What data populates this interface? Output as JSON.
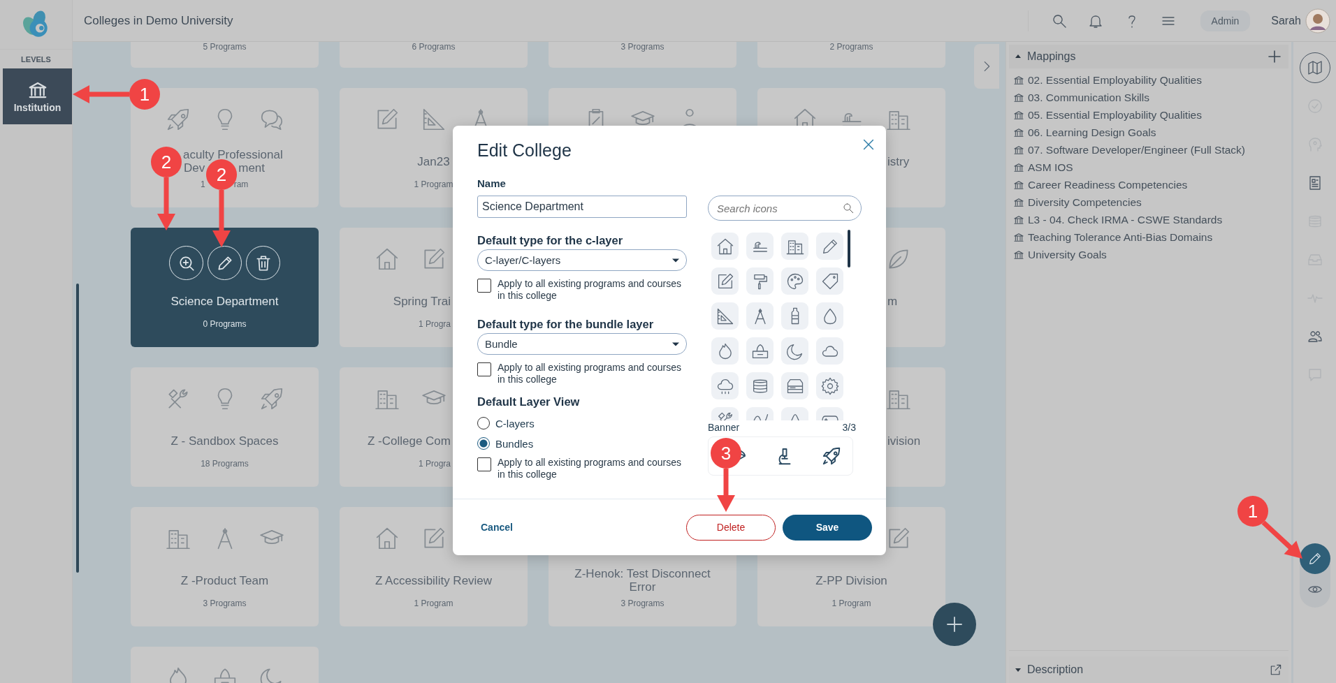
{
  "top_bar": {
    "title": "Colleges in Demo University",
    "role": "Admin",
    "user": "Sarah"
  },
  "sidebar": {
    "heading": "LEVELS",
    "items": [
      {
        "label": "Institution",
        "selected": true
      }
    ]
  },
  "cards": [
    {
      "count": "5 Programs",
      "selected": false
    },
    {
      "count": "6 Programs",
      "selected": false
    },
    {
      "count": "3 Programs",
      "selected": false
    },
    {
      "count": "2 Programs",
      "selected": false
    },
    {
      "title_parts": [
        "aculty Professional",
        "Dev",
        "ment"
      ],
      "count_parts": [
        "1",
        "ram"
      ],
      "selected": false
    },
    {
      "title": "Jan23",
      "count": "1 Program",
      "selected": false
    },
    {
      "selected": false
    },
    {
      "title": "istry",
      "selected": false
    },
    {
      "title": "Science Department",
      "count": "0 Programs",
      "selected": true
    },
    {
      "title": "Spring Trai",
      "count": "1 Progra",
      "selected": false
    },
    {
      "title": "m",
      "selected": false
    },
    {
      "title": "Z - Sandbox Spaces",
      "count": "18 Programs",
      "selected": false
    },
    {
      "title": "Z -College Com",
      "count": "1 Progra",
      "selected": false
    },
    {
      "title": "ivision",
      "selected": false
    },
    {
      "title": "Z -Product Team",
      "count": "3 Programs",
      "selected": false
    },
    {
      "title": "Z Accessibility Review",
      "count": "1 Program",
      "selected": false
    },
    {
      "title": "Z-Henok: Test Disconnect Error",
      "count": "3 Programs",
      "selected": false
    },
    {
      "title": "Z-PP Division",
      "count": "1 Program",
      "selected": false
    },
    {
      "selected": false
    }
  ],
  "panel": {
    "sections": [
      {
        "title": "Mappings",
        "expanded": true,
        "items": [
          "02. Essential Employability Qualities",
          "03. Communication Skills",
          "05. Essential Employability Qualities",
          "06. Learning Design Goals",
          "07. Software Developer/Engineer (Full Stack)",
          "ASM IOS",
          "Career Readiness Competencies",
          "Diversity Competencies",
          "L3 - 04. Check IRMA - CSWE Standards",
          "Teaching Tolerance Anti-Bias Domains",
          "University Goals"
        ]
      },
      {
        "title": "Description",
        "expanded": false
      }
    ]
  },
  "rail": [
    {
      "selected": true,
      "disabled": false
    },
    {
      "selected": false,
      "disabled": true
    },
    {
      "selected": false,
      "disabled": true
    },
    {
      "selected": false,
      "disabled": false
    },
    {
      "selected": false,
      "disabled": true
    },
    {
      "selected": false,
      "disabled": true
    },
    {
      "selected": false,
      "disabled": true
    },
    {
      "selected": false,
      "disabled": false
    },
    {
      "selected": false,
      "disabled": true
    }
  ],
  "mode_toggle": [
    {
      "selected": true
    },
    {
      "selected": false
    }
  ],
  "dialog": {
    "title": "Edit College",
    "name_label": "Name",
    "name_value": "Science Department",
    "fields": [
      {
        "label": "Default type for the c-layer",
        "value": "C-layer/C-layers",
        "apply_label": "Apply to all existing programs and courses in this college",
        "apply_checked": false
      },
      {
        "label": "Default type for the bundle layer",
        "value": "Bundle",
        "apply_label": "Apply to all existing programs and courses in this college",
        "apply_checked": false
      }
    ],
    "view_label": "Default Layer View",
    "view_options": [
      {
        "label": "C-layers",
        "selected": false
      },
      {
        "label": "Bundles",
        "selected": true
      }
    ],
    "view_apply": {
      "label": "Apply to all existing programs and courses in this college",
      "checked": false
    },
    "icon_search_placeholder": "Search icons",
    "banner_label": "Banner",
    "banner_count": "3/3",
    "cancel": "Cancel",
    "delete": "Delete",
    "save": "Save"
  },
  "callouts": [
    {
      "number": "1"
    },
    {
      "number": "2"
    },
    {
      "number": "2"
    },
    {
      "number": "3"
    },
    {
      "number": "1"
    }
  ]
}
